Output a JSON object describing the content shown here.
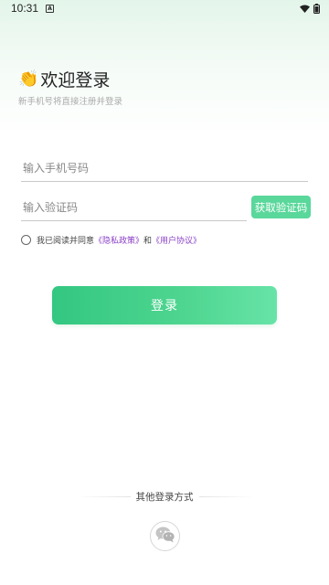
{
  "status_bar": {
    "time": "10:31",
    "notification_icon": "a-badge-icon",
    "wifi_icon": "wifi-icon",
    "battery_icon": "battery-icon"
  },
  "header": {
    "emoji": "👏",
    "title": "欢迎登录",
    "subtitle": "新手机号将直接注册并登录"
  },
  "form": {
    "phone_placeholder": "输入手机号码",
    "code_placeholder": "输入验证码",
    "get_code_label": "获取验证码",
    "agreement": {
      "prefix": "我已阅读并同意",
      "privacy_link": "《隐私政策》",
      "and": "和",
      "user_link": "《用户协议》"
    },
    "login_label": "登录"
  },
  "other_login": {
    "label": "其他登录方式",
    "wechat_icon": "wechat-icon"
  },
  "colors": {
    "accent": "#5ad79b",
    "link": "#8a3fc7"
  }
}
